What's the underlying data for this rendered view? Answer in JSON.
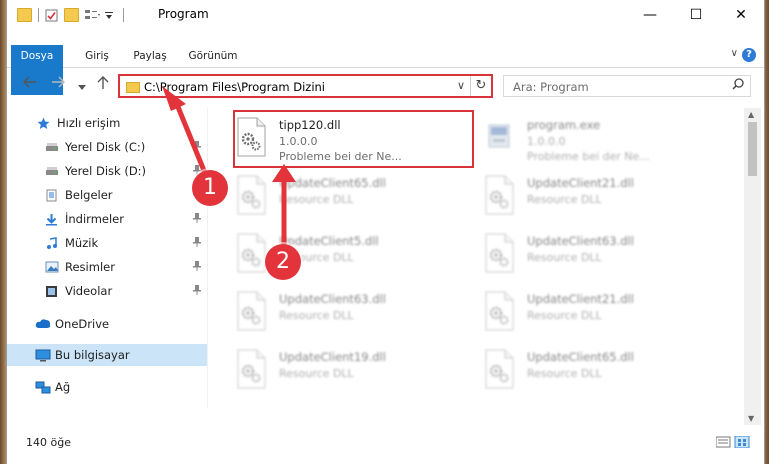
{
  "window": {
    "title": "Program",
    "minimize": "—",
    "maximize": "☐",
    "close": "✕"
  },
  "ribbon": {
    "tabs": [
      "Dosya",
      "Giriş",
      "Paylaş",
      "Görünüm"
    ],
    "help": "?",
    "expand": "∨"
  },
  "address": {
    "path": "C:\\Program Files\\Program Dizini",
    "dropdown": "∨",
    "refresh": "↻"
  },
  "search": {
    "placeholder": "Ara: Program",
    "icon": "search-icon"
  },
  "nav": {
    "items": [
      {
        "label": "Hızlı erişim",
        "icon": "star-icon",
        "pinned": false
      },
      {
        "label": "Yerel Disk (C:)",
        "icon": "drive-icon",
        "pinned": true
      },
      {
        "label": "Yerel Disk (D:)",
        "icon": "drive-icon",
        "pinned": true
      },
      {
        "label": "Belgeler",
        "icon": "documents-icon",
        "pinned": true
      },
      {
        "label": "İndirmeler",
        "icon": "download-icon",
        "pinned": true
      },
      {
        "label": "Müzik",
        "icon": "music-icon",
        "pinned": true
      },
      {
        "label": "Resimler",
        "icon": "pictures-icon",
        "pinned": true
      },
      {
        "label": "Videolar",
        "icon": "videos-icon",
        "pinned": true
      },
      {
        "label": "OneDrive",
        "icon": "cloud-icon",
        "pinned": false
      },
      {
        "label": "Bu bilgisayar",
        "icon": "computer-icon",
        "pinned": false
      },
      {
        "label": "Ağ",
        "icon": "network-icon",
        "pinned": false
      }
    ],
    "pin_glyph": "📌"
  },
  "files": [
    {
      "name": "tipp120.dll",
      "line2": "1.0.0.0",
      "line3": "Probleme bei der Ne...",
      "col": 0,
      "row": 0,
      "blurred": false
    },
    {
      "name": "program.exe",
      "line2": "1.0.0.0",
      "line3": "Probleme bei der Ne...",
      "col": 1,
      "row": 0,
      "blurred": true
    },
    {
      "name": "UpdateClient65.dll",
      "line2": "Resource DLL",
      "line3": "",
      "col": 0,
      "row": 1,
      "blurred": true
    },
    {
      "name": "UpdateClient21.dll",
      "line2": "Resource DLL",
      "line3": "",
      "col": 1,
      "row": 1,
      "blurred": true
    },
    {
      "name": "UpdateClient5.dll",
      "line2": "Resource DLL",
      "line3": "",
      "col": 0,
      "row": 2,
      "blurred": true
    },
    {
      "name": "UpdateClient63.dll",
      "line2": "Resource DLL",
      "line3": "",
      "col": 1,
      "row": 2,
      "blurred": true
    },
    {
      "name": "UpdateClient63.dll",
      "line2": "Resource DLL",
      "line3": "",
      "col": 0,
      "row": 3,
      "blurred": true
    },
    {
      "name": "UpdateClient21.dll",
      "line2": "Resource DLL",
      "line3": "",
      "col": 1,
      "row": 3,
      "blurred": true
    },
    {
      "name": "UpdateClient19.dll",
      "line2": "Resource DLL",
      "line3": "",
      "col": 0,
      "row": 4,
      "blurred": true
    },
    {
      "name": "UpdateClient65.dll",
      "line2": "Resource DLL",
      "line3": "",
      "col": 1,
      "row": 4,
      "blurred": true
    }
  ],
  "status": {
    "count": "140 öğe"
  },
  "annotations": {
    "badge1": "1",
    "badge2": "2",
    "color": "#e2343a"
  }
}
